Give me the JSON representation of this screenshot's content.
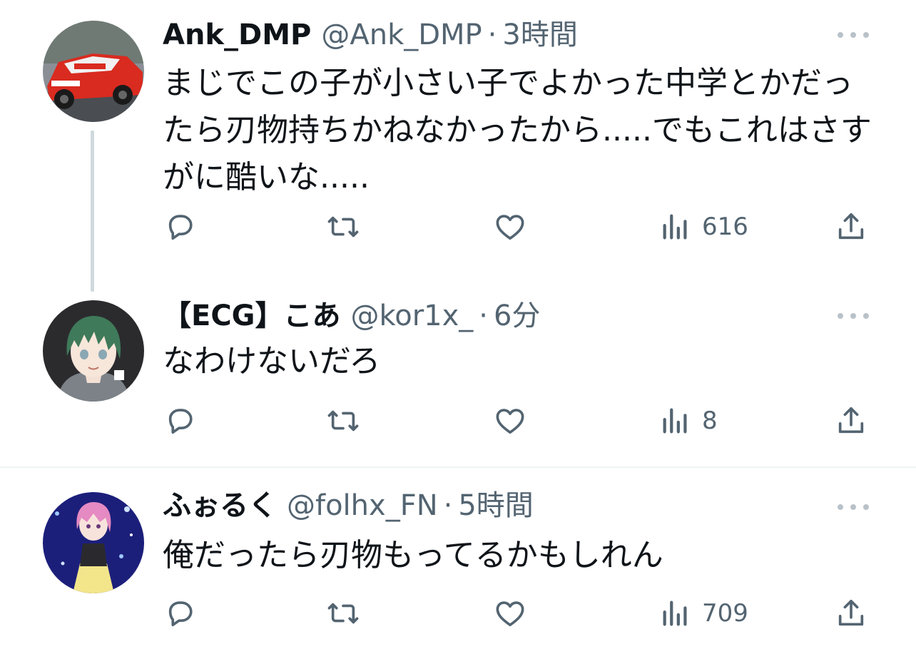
{
  "tweets": [
    {
      "display_name": "Ank_DMP",
      "handle": "@Ank_DMP",
      "separator": "·",
      "time": "3時間",
      "text": "まじでこの子が小さい子でよかった中学とかだったら刃物持ちかねなかったから.....でもこれはさすがに酷いな.....",
      "views": "616",
      "avatar_icon": "race-car-avatar"
    },
    {
      "display_name": "【ECG】こあ",
      "handle": "@kor1x_",
      "separator": "·",
      "time": "6分",
      "text": "なわけないだろ",
      "views": "8",
      "avatar_icon": "anime-character-avatar"
    },
    {
      "display_name": "ふぉるく",
      "handle": "@folhx_FN",
      "separator": "·",
      "time": "5時間",
      "text": "俺だったら刃物もってるかもしれん",
      "views": "709",
      "avatar_icon": "anime-idol-avatar"
    }
  ],
  "colors": {
    "primary_text": "#0f1419",
    "secondary_text": "#536471",
    "thread_line": "#cfd9de",
    "divider": "#eff3f4"
  },
  "icons": [
    "reply-icon",
    "retweet-icon",
    "like-icon",
    "views-icon",
    "share-icon",
    "more-icon"
  ]
}
